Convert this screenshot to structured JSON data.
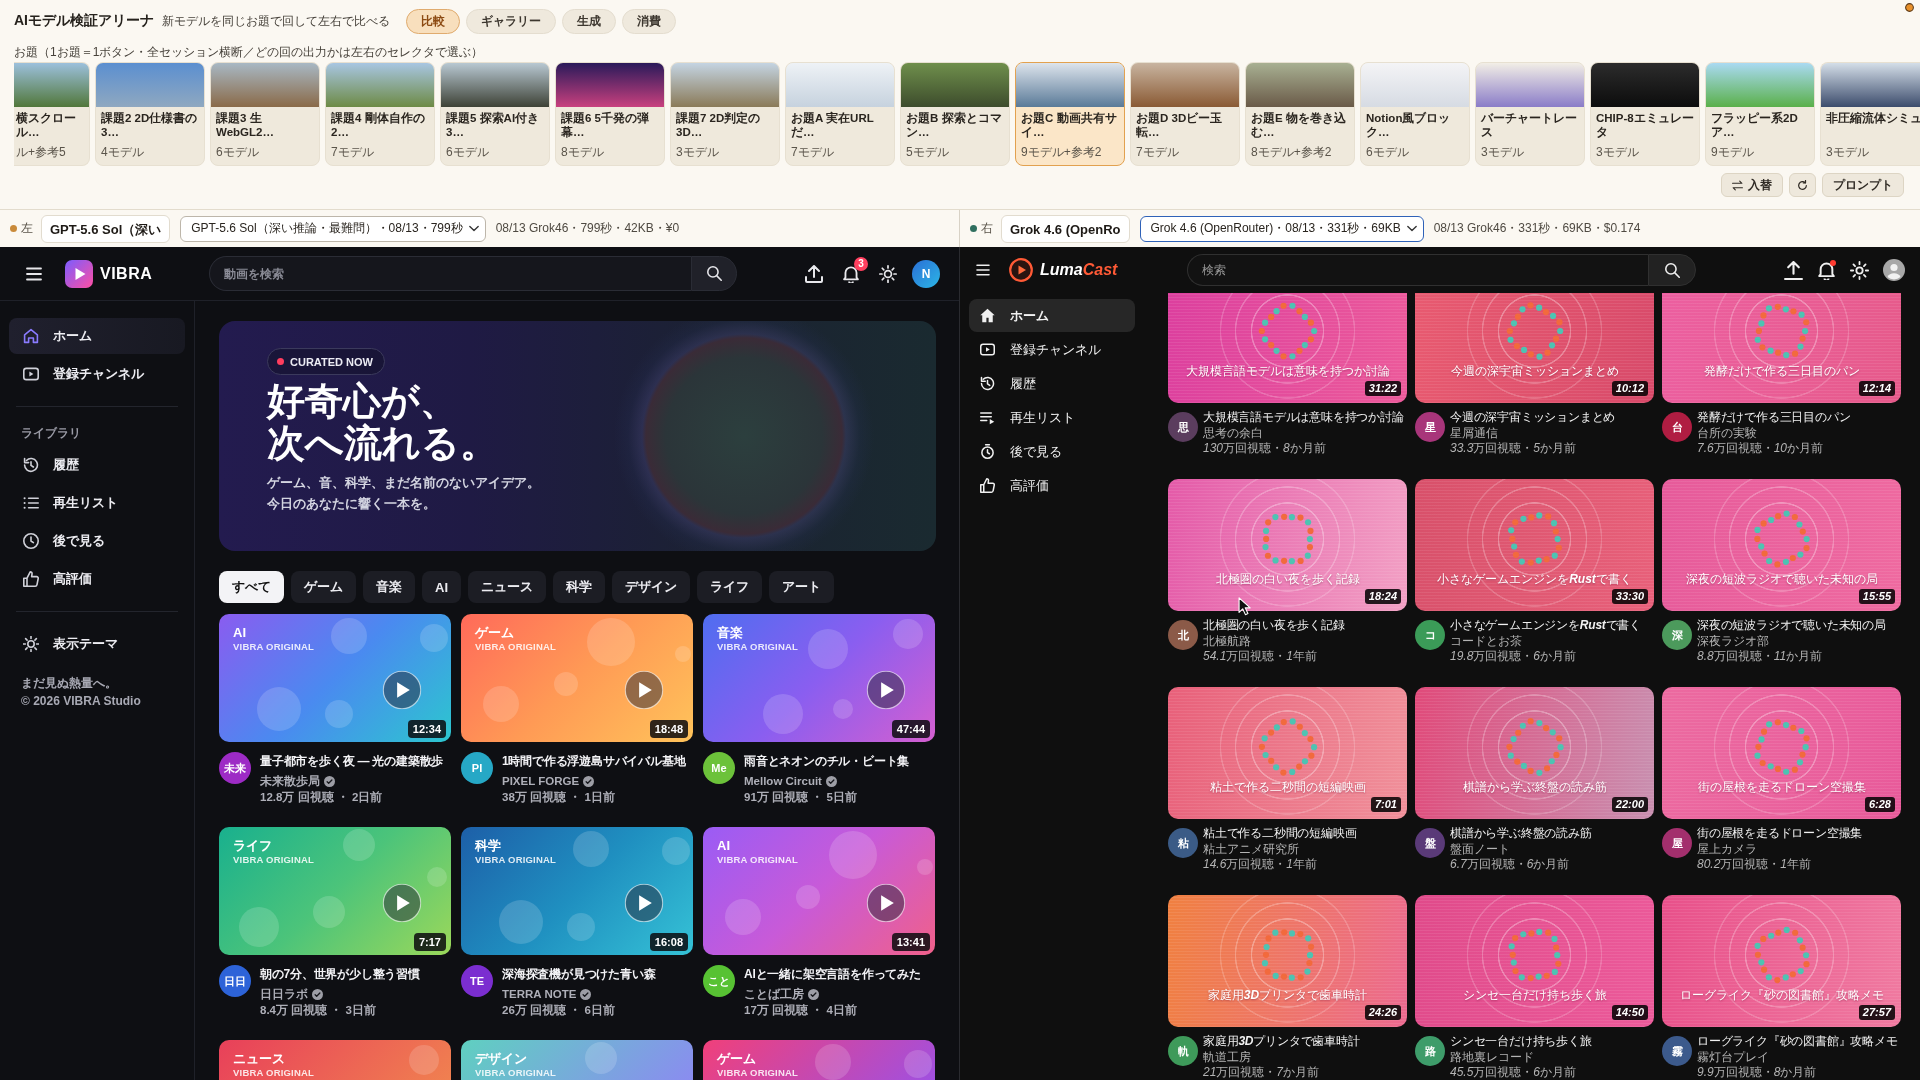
{
  "header": {
    "title": "AIモデル検証アリーナ",
    "subtitle": "新モデルを同じお題で回して左右で比べる"
  },
  "tabs": [
    {
      "label": "比較",
      "selected": true
    },
    {
      "label": "ギャラリー",
      "selected": false
    },
    {
      "label": "生成",
      "selected": false
    },
    {
      "label": "消費",
      "selected": false
    }
  ],
  "prompts": {
    "caption": "お題（1お題＝1ボタン・全セッション横断／どの回の出力かは左右のセレクタで選ぶ）",
    "items": [
      {
        "title": "横スクロール…",
        "meta": "ル+参考5",
        "selected": false
      },
      {
        "title": "課題2 2D仕様書の3…",
        "meta": "4モデル",
        "selected": false
      },
      {
        "title": "課題3 生WebGL2…",
        "meta": "6モデル",
        "selected": false
      },
      {
        "title": "課題4 剛体自作の2…",
        "meta": "7モデル",
        "selected": false
      },
      {
        "title": "課題5 探索AI付き3…",
        "meta": "6モデル",
        "selected": false
      },
      {
        "title": "課題6 5千発の弾幕…",
        "meta": "8モデル",
        "selected": false
      },
      {
        "title": "課題7 2D判定の3D…",
        "meta": "3モデル",
        "selected": false
      },
      {
        "title": "お題A 実在URLだ…",
        "meta": "7モデル",
        "selected": false
      },
      {
        "title": "お題B 探索とコマン…",
        "meta": "5モデル",
        "selected": false
      },
      {
        "title": "お題C 動画共有サイ…",
        "meta": "9モデル+参考2",
        "selected": true
      },
      {
        "title": "お題D 3Dビー玉転…",
        "meta": "7モデル",
        "selected": false
      },
      {
        "title": "お題E 物を巻き込む…",
        "meta": "8モデル+参考2",
        "selected": false
      },
      {
        "title": "Notion風ブロック…",
        "meta": "6モデル",
        "selected": false
      },
      {
        "title": "バーチャートレース",
        "meta": "3モデル",
        "selected": false
      },
      {
        "title": "CHIP-8エミュレータ",
        "meta": "3モデル",
        "selected": false
      },
      {
        "title": "フラッピー系2Dア…",
        "meta": "9モデル",
        "selected": false
      },
      {
        "title": "非圧縮流体シミュ",
        "meta": "3モデル",
        "selected": false
      }
    ]
  },
  "actions": [
    {
      "kind": "swap",
      "label": "入替"
    },
    {
      "kind": "refresh"
    },
    {
      "kind": "prompt",
      "label": "プロンプト"
    }
  ],
  "sides": [
    {
      "label": "左",
      "color": "#c98a3a",
      "name": "GPT-5.6 Sol（深い",
      "session": "GPT-5.6 Sol（深い推論・最難問）・08/13・799秒",
      "meta": "08/13 Grok46・799秒・42KB・¥0",
      "focused": false
    },
    {
      "label": "右",
      "color": "#2f6f5f",
      "name": "Grok 4.6 (OpenRo",
      "session": "Grok 4.6 (OpenRouter)・08/13・331秒・69KB",
      "meta": "08/13 Grok46・331秒・69KB・$0.174",
      "focused": true
    }
  ],
  "left_app": {
    "logo": "VIBRA",
    "search": {
      "placeholder": "動画を検索"
    },
    "notifications": "3",
    "avatar": "N",
    "sidebar": {
      "main": [
        {
          "kind": "home",
          "label": "ホーム",
          "selected": true
        },
        {
          "kind": "subscriptions",
          "label": "登録チャンネル",
          "selected": false
        }
      ],
      "library_heading": "ライブラリ",
      "library": [
        {
          "kind": "history",
          "label": "履歴",
          "selected": false
        },
        {
          "kind": "playlist",
          "label": "再生リスト",
          "selected": false
        },
        {
          "kind": "watch_later",
          "label": "後で見る",
          "selected": false
        },
        {
          "kind": "liked",
          "label": "高評価",
          "selected": false
        }
      ],
      "bottom": [
        {
          "kind": "theme",
          "label": "表示テーマ",
          "selected": false
        }
      ],
      "tagline": "まだ見ぬ熱量へ。",
      "copyright": "© 2026 VIBRA Studio"
    },
    "hero": {
      "badge": "CURATED NOW",
      "headline": [
        "好奇心が、",
        "次へ流れる。"
      ],
      "description": [
        "ゲーム、音、科学、まだ名前のないアイデア。",
        "今日のあなたに響く一本を。"
      ]
    },
    "chips": [
      {
        "label": "すべて",
        "selected": true
      },
      {
        "label": "ゲーム",
        "selected": false
      },
      {
        "label": "音楽",
        "selected": false
      },
      {
        "label": "AI",
        "selected": false
      },
      {
        "label": "ニュース",
        "selected": false
      },
      {
        "label": "科学",
        "selected": false
      },
      {
        "label": "デザイン",
        "selected": false
      },
      {
        "label": "ライフ",
        "selected": false
      },
      {
        "label": "アート",
        "selected": false
      }
    ],
    "videos": [
      {
        "category": "AI",
        "label": "VIBRA ORIGINAL",
        "duration": "12:34",
        "avatar": "未来",
        "color": "#9d2bc5",
        "title": "量子都市を歩く夜 ― 光の建築散歩",
        "channel": "未来散歩局",
        "verified": true,
        "stats": "12.8万 回視聴 ・ 2日前"
      },
      {
        "category": "ゲーム",
        "label": "VIBRA ORIGINAL",
        "duration": "18:48",
        "avatar": "PI",
        "color": "#26a8c6",
        "title": "1時間で作る浮遊島サバイバル基地",
        "channel": "PIXEL FORGE",
        "verified": true,
        "stats": "38万 回視聴 ・ 1日前"
      },
      {
        "category": "音楽",
        "label": "VIBRA ORIGINAL",
        "duration": "47:44",
        "avatar": "Me",
        "color": "#6cc23a",
        "title": "雨音とネオンのチル・ビート集",
        "channel": "Mellow Circuit",
        "verified": true,
        "stats": "91万 回視聴 ・ 5日前"
      },
      {
        "category": "ライフ",
        "label": "VIBRA ORIGINAL",
        "duration": "7:17",
        "avatar": "日日",
        "color": "#2d63d8",
        "title": "朝の7分、世界が少し整う習慣",
        "channel": "日日ラボ",
        "verified": true,
        "stats": "8.4万 回視聴 ・ 3日前"
      },
      {
        "category": "科学",
        "label": "VIBRA ORIGINAL",
        "duration": "16:08",
        "avatar": "TE",
        "color": "#7b2ed0",
        "title": "深海探査機が見つけた青い森",
        "channel": "TERRA NOTE",
        "verified": true,
        "stats": "26万 回視聴 ・ 6日前"
      },
      {
        "category": "AI",
        "label": "VIBRA ORIGINAL",
        "duration": "13:41",
        "avatar": "こと",
        "color": "#57c233",
        "title": "AIと一緒に架空言語を作ってみた",
        "channel": "ことば工房",
        "verified": true,
        "stats": "17万 回視聴 ・ 4日前"
      },
      {
        "category": "ニュース",
        "label": "VIBRA ORIGINAL"
      },
      {
        "category": "デザイン",
        "label": "VIBRA ORIGINAL"
      },
      {
        "category": "ゲーム",
        "label": "VIBRA ORIGINAL"
      }
    ]
  },
  "right_app": {
    "logo": [
      "Luma",
      "Cast"
    ],
    "search": {
      "placeholder": "検索"
    },
    "unread": true,
    "sidebar": [
      {
        "kind": "home",
        "label": "ホーム",
        "selected": true
      },
      {
        "kind": "subscriptions",
        "label": "登録チャンネル",
        "selected": false
      },
      {
        "kind": "history",
        "label": "履歴",
        "selected": false
      },
      {
        "kind": "playlist",
        "label": "再生リスト",
        "selected": false
      },
      {
        "kind": "watch_later",
        "label": "後で見る",
        "selected": false
      },
      {
        "kind": "liked",
        "label": "高評価",
        "selected": false
      }
    ],
    "videos": [
      {
        "caption": "大規模言語モデルは意味を持つか討論",
        "duration": "31:22",
        "avatar": "思",
        "color": "#5b3d5e",
        "title": "大規模言語モデルは意味を持つか討論",
        "channel": "思考の余白",
        "stats": "130万回視聴・8か月前"
      },
      {
        "caption": "今週の深宇宙ミッションまとめ",
        "duration": "10:12",
        "avatar": "星",
        "color": "#a8357a",
        "title": "今週の深宇宙ミッションまとめ",
        "channel": "星屑通信",
        "stats": "33.3万回視聴・5か月前"
      },
      {
        "caption": "発酵だけで作る三日目のパン",
        "duration": "12:14",
        "avatar": "台",
        "color": "#b01d42",
        "title": "発酵だけで作る三日目のパン",
        "channel": "台所の実験",
        "stats": "7.6万回視聴・10か月前"
      },
      {
        "caption": "北極圏の白い夜を歩く記録",
        "duration": "18:24",
        "avatar": "北",
        "color": "#8b5a48",
        "title": "北極圏の白い夜を歩く記録",
        "channel": "北極航路",
        "stats": "54.1万回視聴・1年前"
      },
      {
        "caption": "小さなゲームエンジンをRustで書く",
        "duration": "33:30",
        "avatar": "コ",
        "color": "#3b9b58",
        "title": "小さなゲームエンジンをRustで書く",
        "channel": "コードとお茶",
        "stats": "19.8万回視聴・6か月前"
      },
      {
        "caption": "深夜の短波ラジオで聴いた未知の局",
        "duration": "15:55",
        "avatar": "深",
        "color": "#4c9a5c",
        "title": "深夜の短波ラジオで聴いた未知の局",
        "channel": "深夜ラジオ部",
        "stats": "8.8万回視聴・11か月前"
      },
      {
        "caption": "粘土で作る二秒間の短編映画",
        "duration": "7:01",
        "avatar": "粘",
        "color": "#3b5b86",
        "title": "粘土で作る二秒間の短編映画",
        "channel": "粘土アニメ研究所",
        "stats": "14.6万回視聴・1年前"
      },
      {
        "caption": "棋譜から学ぶ終盤の読み筋",
        "duration": "22:00",
        "avatar": "盤",
        "color": "#5a3a78",
        "title": "棋譜から学ぶ終盤の読み筋",
        "channel": "盤面ノート",
        "stats": "6.7万回視聴・6か月前"
      },
      {
        "caption": "街の屋根を走るドローン空撮集",
        "duration": "6:28",
        "avatar": "屋",
        "color": "#a32f6d",
        "title": "街の屋根を走るドローン空撮集",
        "channel": "屋上カメラ",
        "stats": "80.2万回視聴・1年前"
      },
      {
        "caption": "家庭用3Dプリンタで歯車時計",
        "duration": "24:26",
        "avatar": "軌",
        "color": "#3e9a5a",
        "title": "家庭用3Dプリンタで歯車時計",
        "channel": "軌道工房",
        "stats": "21万回視聴・7か月前"
      },
      {
        "caption": "シンセ一台だけ持ち歩く旅",
        "duration": "14:50",
        "avatar": "路",
        "color": "#3e9c6a",
        "title": "シンセ一台だけ持ち歩く旅",
        "channel": "路地裏レコード",
        "stats": "45.5万回視聴・6か月前"
      },
      {
        "caption": "ローグライク『砂の図書館』攻略メモ",
        "duration": "27:57",
        "avatar": "霧",
        "color": "#3c5a8c",
        "title": "ローグライク『砂の図書館』攻略メモ",
        "channel": "霧灯台プレイ",
        "stats": "9.9万回視聴・8か月前"
      }
    ]
  }
}
